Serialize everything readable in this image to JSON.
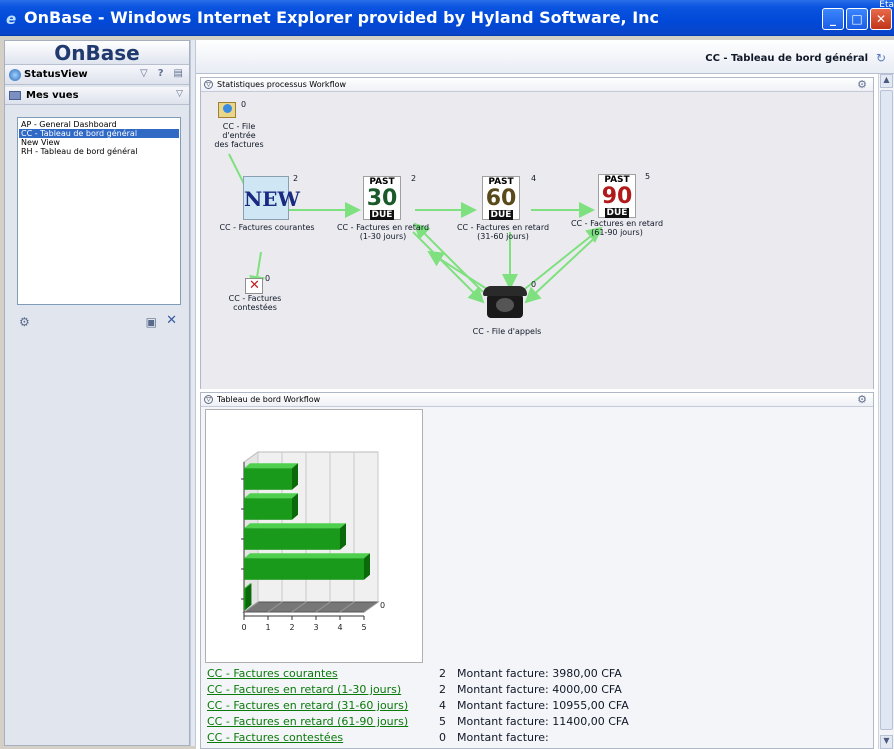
{
  "window": {
    "title": "OnBase - Windows Internet Explorer provided by Hyland Software, Inc",
    "overlay_text": "Eta"
  },
  "sidebar": {
    "logo": "OnBase",
    "statusview_label": "StatusView",
    "mes_vues_label": "Mes vues",
    "views": [
      {
        "label": "AP - General Dashboard",
        "selected": false
      },
      {
        "label": "CC - Tableau de bord général",
        "selected": true
      },
      {
        "label": "New View",
        "selected": false
      },
      {
        "label": "RH - Tableau de bord général",
        "selected": false
      }
    ]
  },
  "main": {
    "header_title": "CC - Tableau de bord général",
    "panel1_title": "Statistiques processus Workflow",
    "panel2_title": "Tableau de bord Workflow"
  },
  "workflow": {
    "nodes": {
      "file_entree": {
        "label_line1": "CC - File d'entrée",
        "label_line2": "des factures",
        "count": "0"
      },
      "courantes": {
        "label": "CC - Factures courantes",
        "count": "2",
        "icon_text": "NEW"
      },
      "retard_30": {
        "label_line1": "CC - Factures en retard",
        "label_line2": "(1-30 jours)",
        "count": "2",
        "past": "PAST",
        "num": "30",
        "due": "DUE"
      },
      "retard_60": {
        "label_line1": "CC - Factures en retard",
        "label_line2": "(31-60 jours)",
        "count": "4",
        "past": "PAST",
        "num": "60",
        "due": "DUE"
      },
      "retard_90": {
        "label_line1": "CC - Factures en retard",
        "label_line2": "(61-90 jours)",
        "count": "5",
        "past": "PAST",
        "num": "90",
        "due": "DUE"
      },
      "contestees": {
        "label_line1": "CC - Factures",
        "label_line2": "contestées",
        "count": "0"
      },
      "appels": {
        "label": "CC - File d'appels",
        "count": "0"
      }
    },
    "colors": {
      "arrow": "#7fe07f",
      "num_30": "#1a5a2a",
      "num_60": "#5a4a1a",
      "num_90": "#b01a1a"
    }
  },
  "chart_data": {
    "type": "bar",
    "orientation": "horizontal",
    "categories": [
      "CC - Factures courantes",
      "CC - Factures en retard (1-30 jours)",
      "CC - Factures en retard (31-60 jours)",
      "CC - Factures en retard (61-90 jours)",
      "CC - Factures contestées"
    ],
    "values": [
      2,
      2,
      4,
      5,
      0
    ],
    "xlim": [
      0,
      5
    ],
    "x_ticks": [
      "0",
      "1",
      "2",
      "3",
      "4",
      "5"
    ],
    "depth_label": "0",
    "bar_color": "#1a9a1a"
  },
  "dashboard_rows": [
    {
      "name": "CC - Factures courantes",
      "count": "2",
      "amount": "Montant facture: 3980,00 CFA"
    },
    {
      "name": "CC - Factures en retard (1-30 jours)",
      "count": "2",
      "amount": "Montant facture: 4000,00 CFA"
    },
    {
      "name": "CC - Factures en retard (31-60 jours)",
      "count": "4",
      "amount": "Montant facture: 10955,00 CFA"
    },
    {
      "name": "CC - Factures en retard (61-90 jours)",
      "count": "5",
      "amount": "Montant facture: 11400,00 CFA"
    },
    {
      "name": "CC - Factures contestées",
      "count": "0",
      "amount": "Montant facture:"
    }
  ]
}
